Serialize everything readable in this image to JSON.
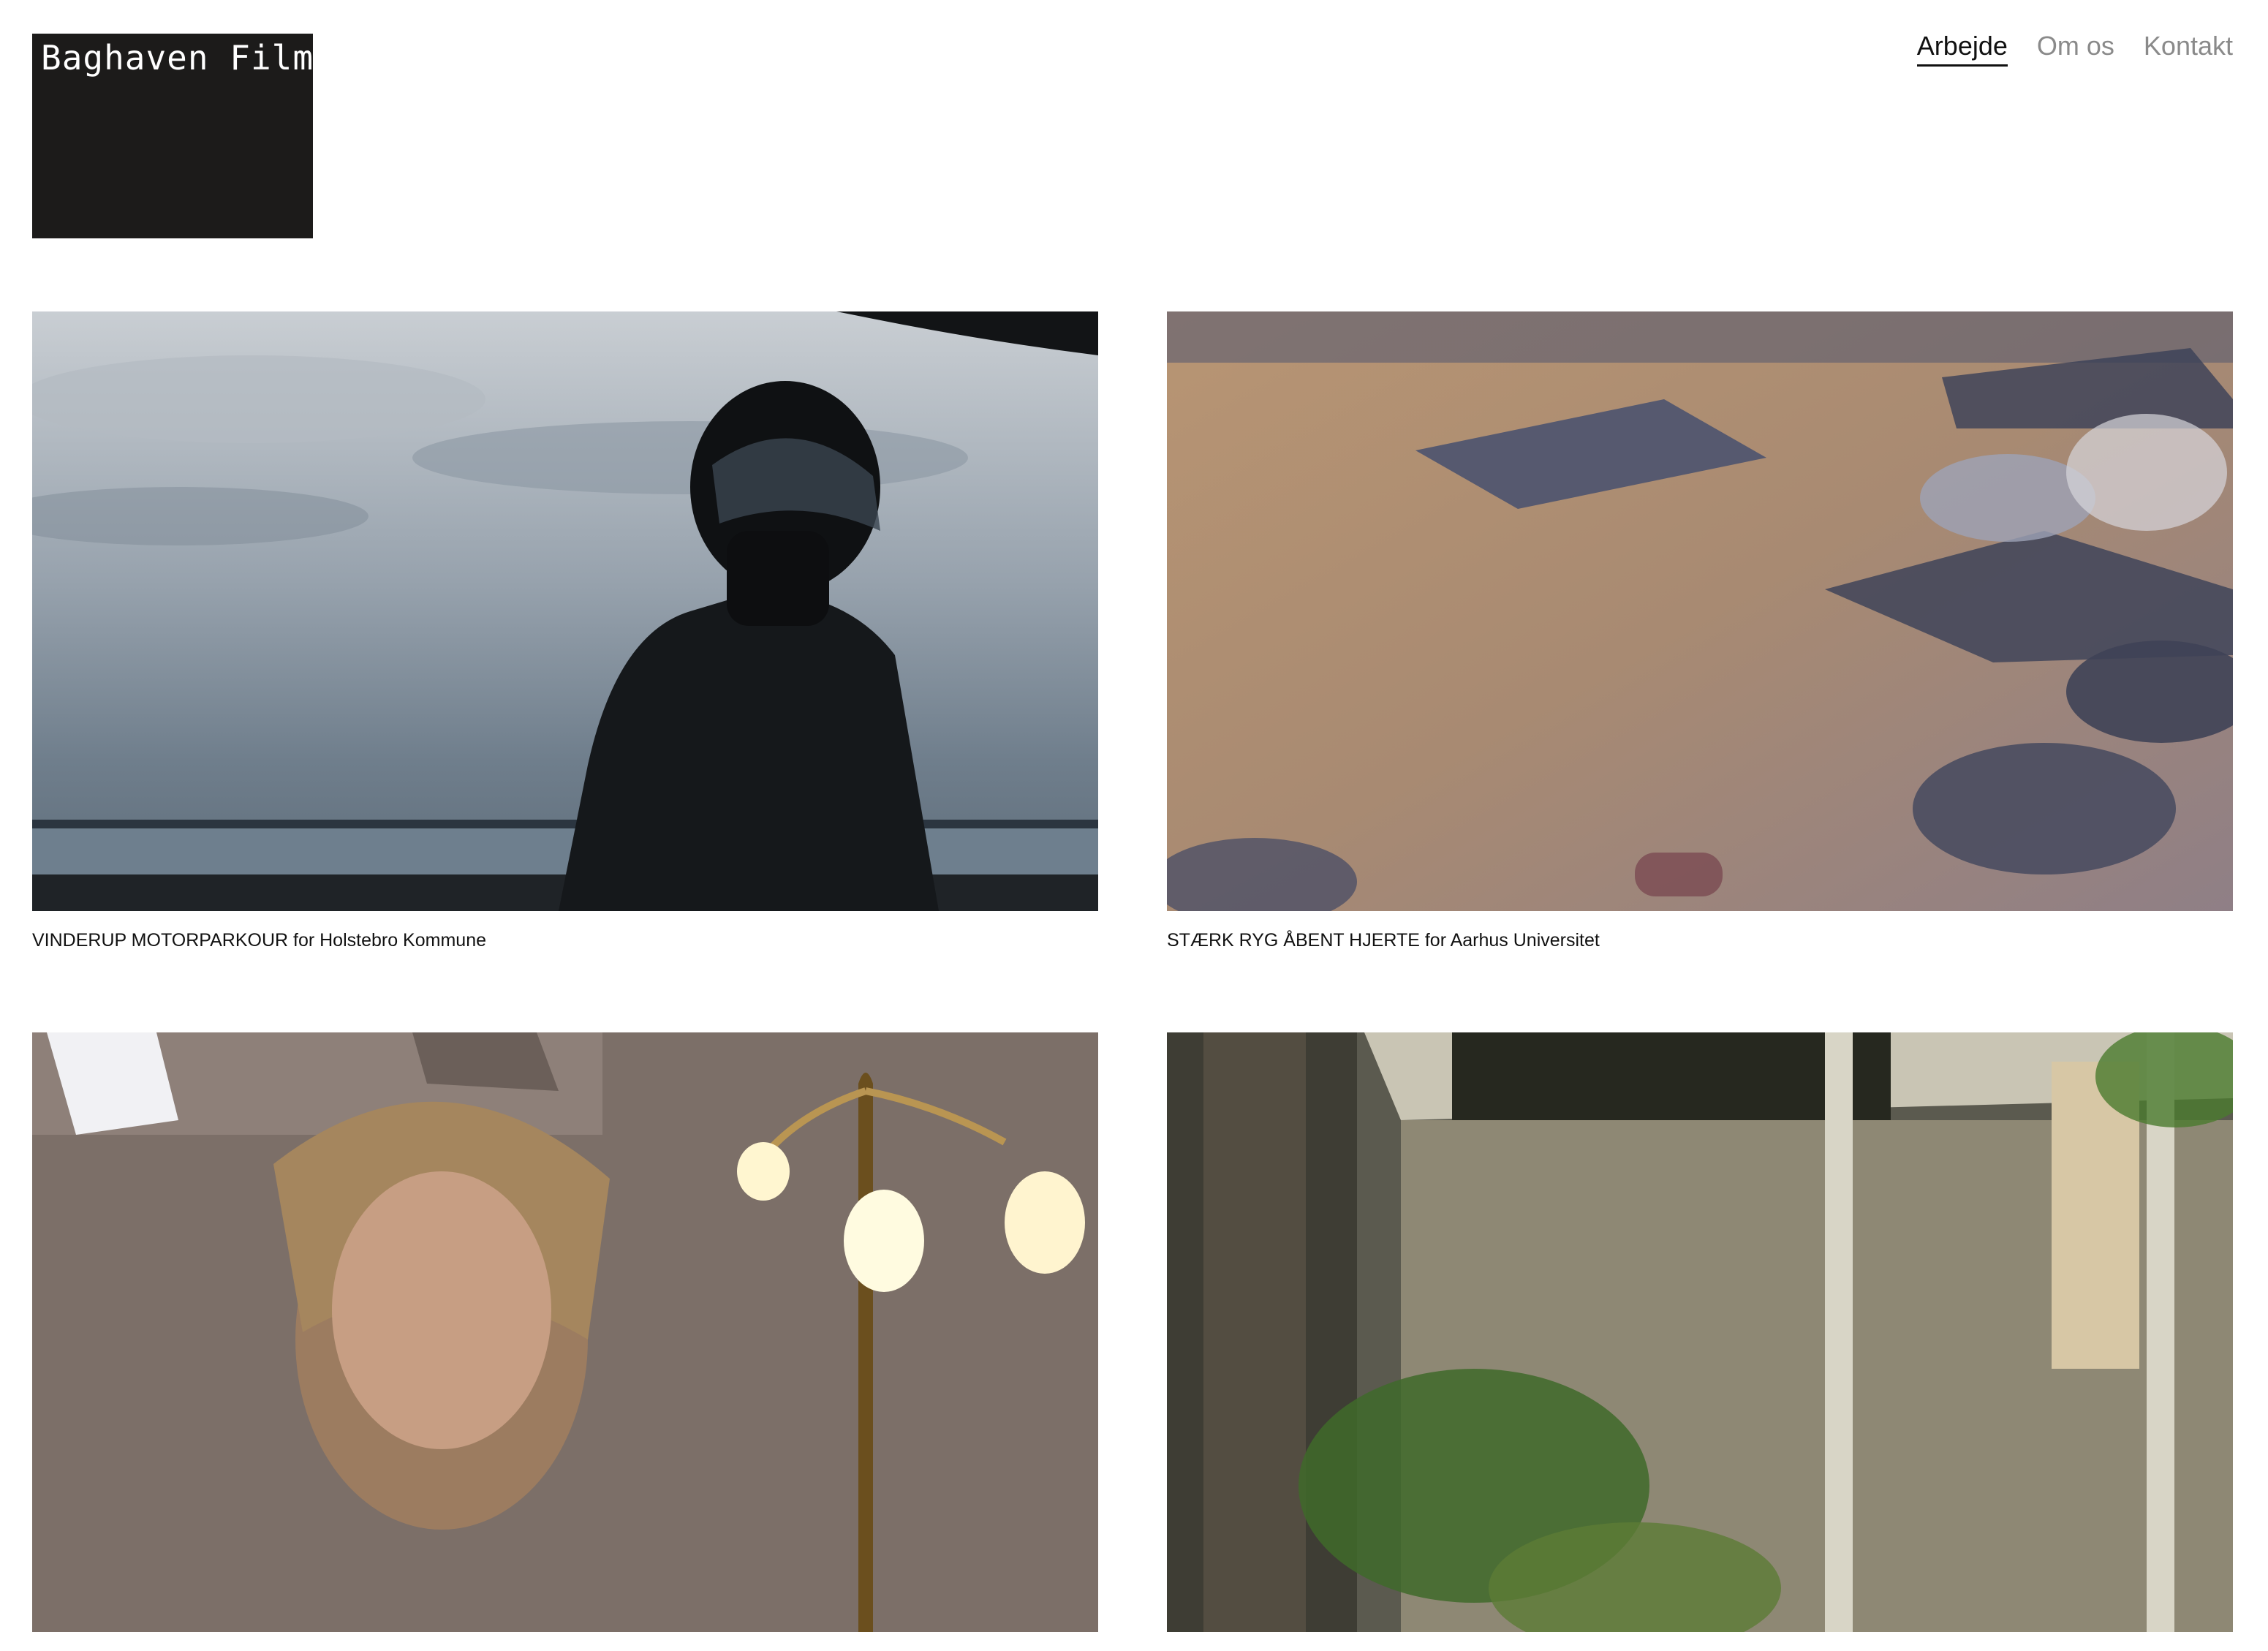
{
  "brand": {
    "name": "Baghaven Film"
  },
  "nav": {
    "items": [
      {
        "label": "Arbejde",
        "active": true
      },
      {
        "label": "Om os",
        "active": false
      },
      {
        "label": "Kontakt",
        "active": false
      }
    ]
  },
  "projects": [
    {
      "caption": "VINDERUP MOTORPARKOUR for Holstebro Kommune",
      "image": "motorcyclist-helmet-lake-dusk"
    },
    {
      "caption": "STÆRK RYG ÅBENT HJERTE for Aarhus Universitet",
      "image": "people-lying-on-yoga-mats-reflection"
    },
    {
      "caption": "",
      "image": "woman-with-bulb-lamp"
    },
    {
      "caption": "",
      "image": "house-porch-with-trees"
    }
  ]
}
